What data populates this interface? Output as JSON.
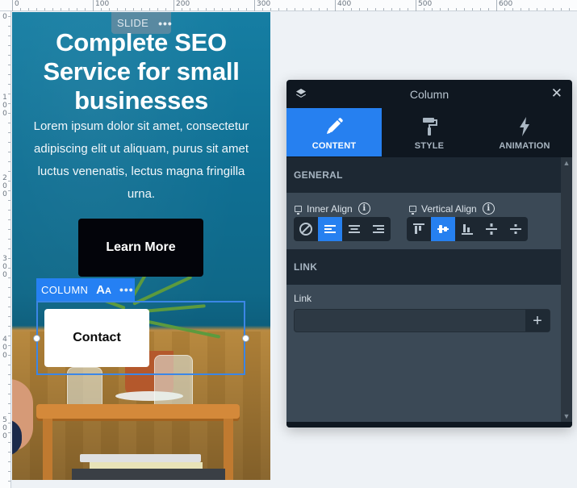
{
  "rulers": {
    "top_labels": [
      "0",
      "100",
      "200",
      "300",
      "400",
      "500",
      "600"
    ],
    "left_labels": [
      "0",
      "100",
      "200",
      "300",
      "400",
      "500"
    ]
  },
  "canvas": {
    "slide_tag": {
      "label": "SLIDE",
      "menu_icon": "more-dots-icon"
    },
    "hero": {
      "title": "Complete SEO Service for small businesses",
      "text": "Lorem ipsum dolor sit amet, consectetur adipiscing elit ut aliquam, purus sit amet luctus venenatis, lectus magna fringilla urna."
    },
    "buttons": {
      "learn_more": "Learn More",
      "contact": "Contact"
    },
    "column_toolbar": {
      "label": "COLUMN",
      "typography_icon": "Aa",
      "menu_icon": "more-dots-icon"
    }
  },
  "panel": {
    "title": "Column",
    "tabs": [
      {
        "label": "CONTENT",
        "icon": "pencil-icon",
        "active": true
      },
      {
        "label": "STYLE",
        "icon": "paint-roller-icon",
        "active": false
      },
      {
        "label": "ANIMATION",
        "icon": "lightning-icon",
        "active": false
      }
    ],
    "sections": {
      "general": {
        "heading": "GENERAL",
        "inner_align": {
          "label": "Inner Align",
          "options": [
            "none",
            "left",
            "center",
            "right"
          ],
          "selected": "left"
        },
        "vertical_align": {
          "label": "Vertical Align",
          "options": [
            "top",
            "middle",
            "bottom",
            "space-between",
            "space-around"
          ],
          "selected": "middle"
        }
      },
      "link": {
        "heading": "LINK",
        "field_label": "Link",
        "value": "",
        "add_label": "+"
      }
    }
  },
  "colors": {
    "accent": "#2680f0",
    "panel_bg": "#0f1720",
    "panel_body": "#3b4956",
    "section_head": "#1d2833",
    "slide_bg": "#0f6f93"
  }
}
